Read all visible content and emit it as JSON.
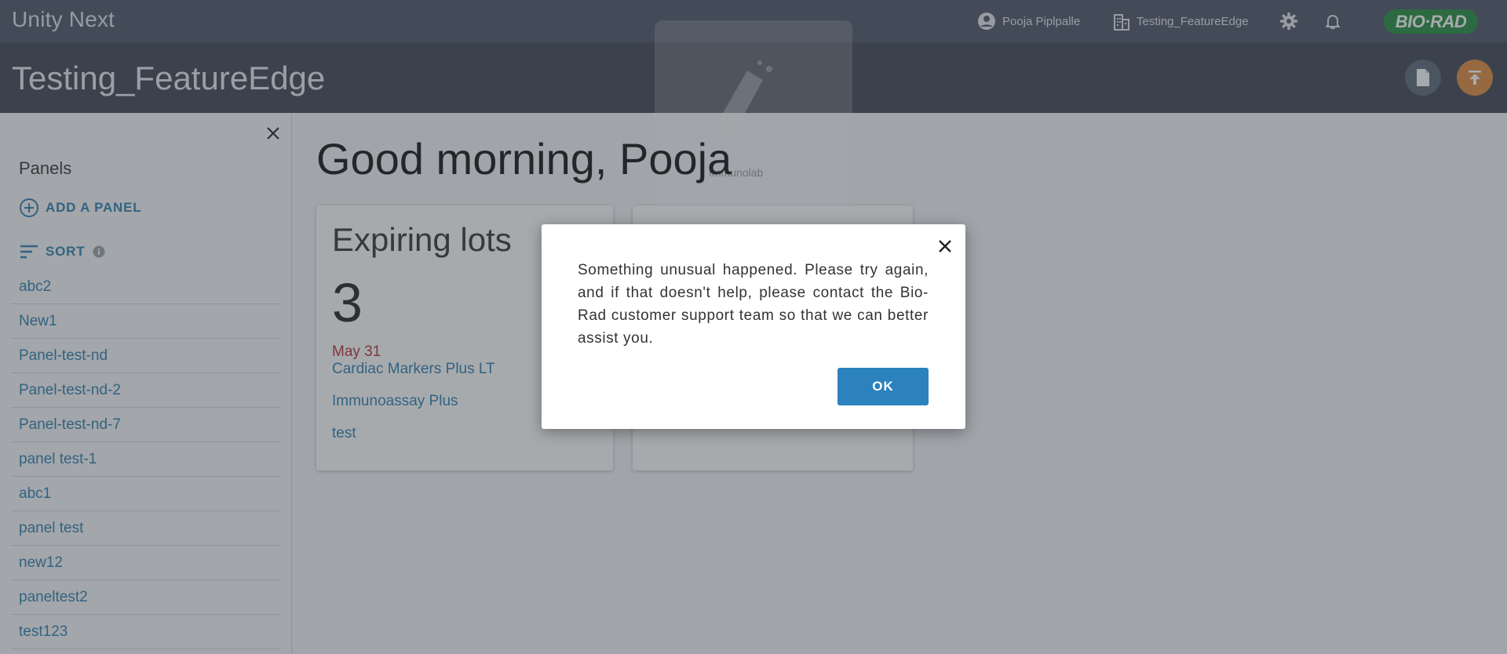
{
  "topbar": {
    "app_name": "Unity Next",
    "user_name": "Pooja Piplpalle",
    "lab_name": "Testing_FeatureEdge",
    "brand_text": "BIO·RAD"
  },
  "header": {
    "title": "Testing_FeatureEdge"
  },
  "sidebar": {
    "title": "Panels",
    "add_label": "ADD A PANEL",
    "sort_label": "SORT",
    "items": [
      {
        "label": "abc2"
      },
      {
        "label": "New1"
      },
      {
        "label": "Panel-test-nd"
      },
      {
        "label": "Panel-test-nd-2"
      },
      {
        "label": "Panel-test-nd-7"
      },
      {
        "label": "panel test-1"
      },
      {
        "label": "abc1"
      },
      {
        "label": "panel test"
      },
      {
        "label": "new12"
      },
      {
        "label": "paneltest2"
      },
      {
        "label": "test123"
      }
    ]
  },
  "main": {
    "greeting": "Good morning, Pooja",
    "expiring": {
      "title": "Expiring lots",
      "count": "3",
      "date": "May 31",
      "items": [
        "Cardiac Markers Plus LT",
        "Immunoassay Plus",
        "test"
      ]
    },
    "ghost_text": "Immunolab"
  },
  "dialog": {
    "message": "Something unusual happened. Please try again, and if that doesn't help, please contact the Bio-Rad customer support team so that we can better assist you.",
    "ok_label": "OK"
  },
  "colors": {
    "topbar": "#4a5366",
    "header": "#3b4252",
    "link": "#2b7fb0",
    "ok_button": "#2b82bd",
    "upload_button": "#e0893a",
    "brand": "#1f8a3b",
    "date_red": "#b22e2e"
  },
  "icons": [
    "account-circle-icon",
    "building-icon",
    "gear-icon",
    "bell-icon",
    "document-icon",
    "upload-icon",
    "close-icon",
    "add-circle-icon",
    "sort-icon",
    "info-icon",
    "test-tube-icon"
  ]
}
